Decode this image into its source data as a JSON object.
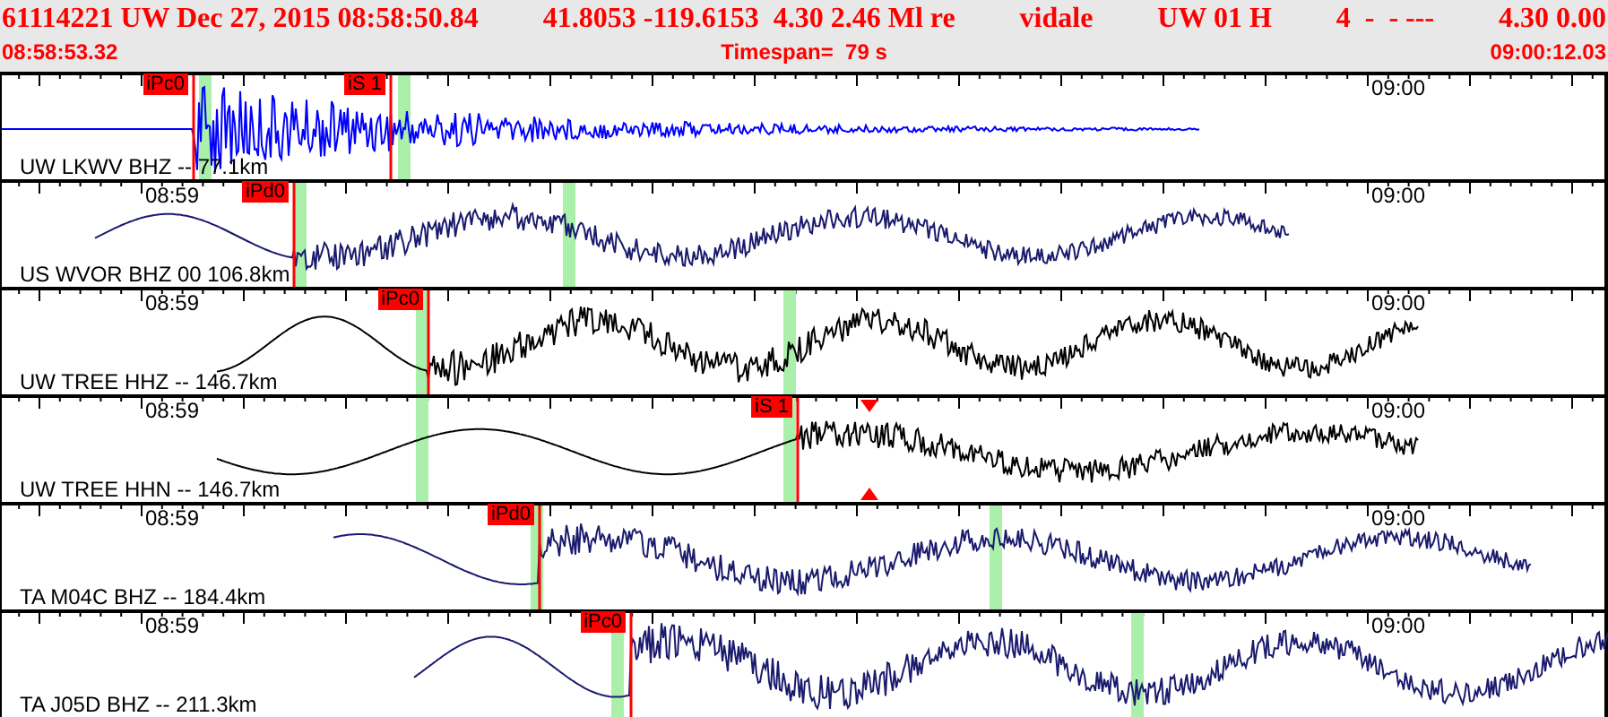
{
  "header": {
    "event": "61114221 UW Dec 27, 2015 08:58:50.84",
    "location": "41.8053 -119.6153  4.30 2.46 Ml re",
    "analyst": "vidale",
    "source": "UW 01 H",
    "fields": "4  -  - ---",
    "values": "4.30 0.00",
    "start_time": "08:58:53.32",
    "timespan": "Timespan=  79 s",
    "end_time": "09:00:12.03"
  },
  "traces": [
    {
      "station": "UW LKWV BHZ -- 77.1km",
      "end_label": "09:00",
      "color": "#0000ff",
      "picks": [
        "iPc0",
        "iS 1"
      ]
    },
    {
      "station": "US WVOR BHZ 00 106.8km",
      "start_label": "08:59",
      "end_label": "09:00",
      "color": "#1a1a6e",
      "picks": [
        "iPd0"
      ]
    },
    {
      "station": "UW TREE HHZ -- 146.7km",
      "start_label": "08:59",
      "end_label": "09:00",
      "color": "#000000",
      "picks": [
        "iPc0"
      ]
    },
    {
      "station": "UW TREE HHN -- 146.7km",
      "start_label": "08:59",
      "end_label": "09:00",
      "color": "#000000",
      "picks": [
        "iS 1"
      ]
    },
    {
      "station": "TA M04C BHZ -- 184.4km",
      "start_label": "08:59",
      "end_label": "09:00",
      "color": "#1a1a6e",
      "picks": [
        "iPd0"
      ]
    },
    {
      "station": "TA J05D BHZ -- 211.3km",
      "start_label": "08:59",
      "end_label": "09:00",
      "color": "#1a1a6e",
      "picks": [
        "iPc0"
      ]
    }
  ]
}
